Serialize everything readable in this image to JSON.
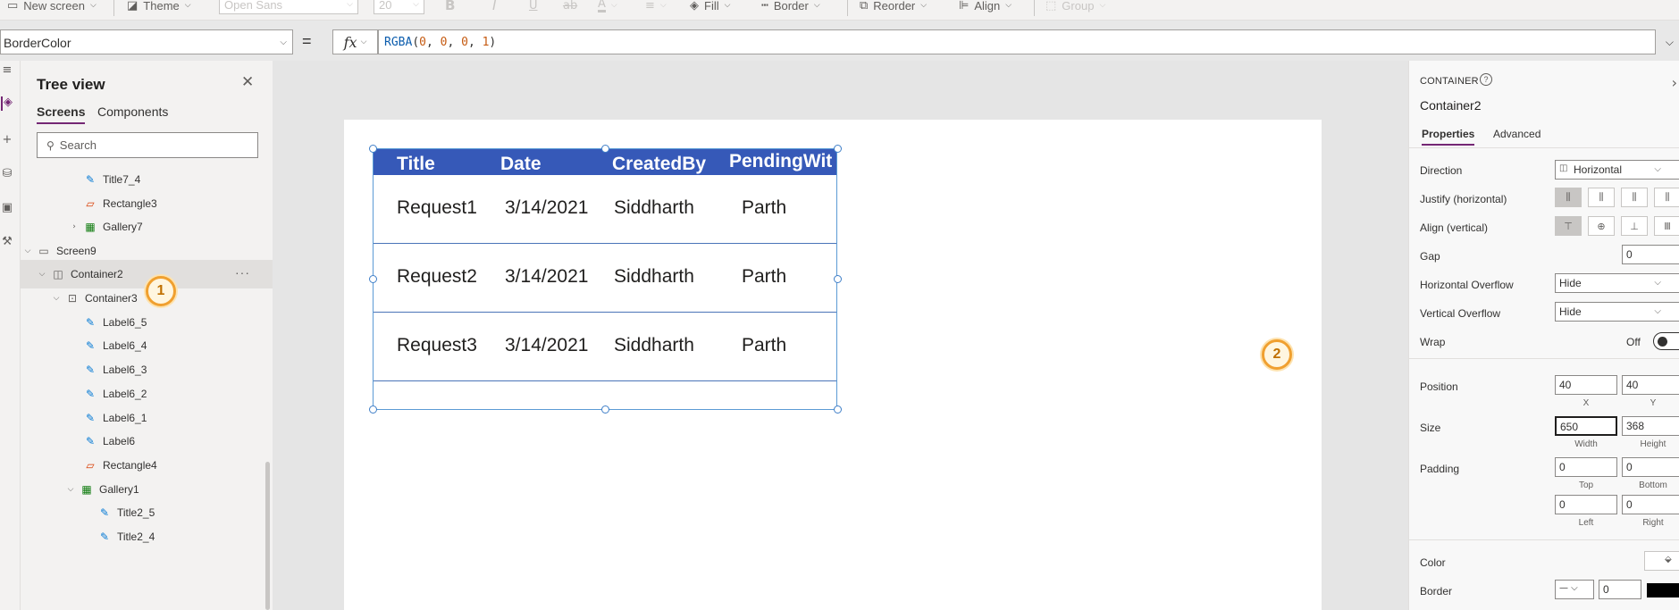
{
  "toolbar": {
    "new_screen": "New screen",
    "theme": "Theme",
    "font": "Open Sans",
    "font_size": "20",
    "fill": "Fill",
    "border": "Border",
    "reorder": "Reorder",
    "align": "Align",
    "group": "Group"
  },
  "formula_bar": {
    "property": "BorderColor",
    "equals": "=",
    "fx": "fx",
    "func": "RGBA",
    "args": [
      "0",
      "0",
      "0",
      "1"
    ]
  },
  "tree_view": {
    "title": "Tree view",
    "tabs": [
      "Screens",
      "Components"
    ],
    "search_placeholder": "Search",
    "items": [
      {
        "label": "Title7_4",
        "type": "label"
      },
      {
        "label": "Rectangle3",
        "type": "rectangle"
      },
      {
        "label": "Gallery7",
        "type": "gallery"
      },
      {
        "label": "Screen9",
        "type": "screen"
      },
      {
        "label": "Container2",
        "type": "container"
      },
      {
        "label": "Container3",
        "type": "container"
      },
      {
        "label": "Label6_5",
        "type": "label"
      },
      {
        "label": "Label6_4",
        "type": "label"
      },
      {
        "label": "Label6_3",
        "type": "label"
      },
      {
        "label": "Label6_2",
        "type": "label"
      },
      {
        "label": "Label6_1",
        "type": "label"
      },
      {
        "label": "Label6",
        "type": "label"
      },
      {
        "label": "Rectangle4",
        "type": "rectangle"
      },
      {
        "label": "Gallery1",
        "type": "gallery"
      },
      {
        "label": "Title2_5",
        "type": "label"
      },
      {
        "label": "Title2_4",
        "type": "label"
      }
    ]
  },
  "callouts": [
    "1",
    "2"
  ],
  "gallery": {
    "headers": [
      "Title",
      "Date",
      "CreatedBy",
      "PendingWit"
    ],
    "rows": [
      [
        "Request1",
        "3/14/2021",
        "Siddharth",
        "Parth"
      ],
      [
        "Request2",
        "3/14/2021",
        "Siddharth",
        "Parth"
      ],
      [
        "Request3",
        "3/14/2021",
        "Siddharth",
        "Parth"
      ]
    ]
  },
  "properties": {
    "control_type": "CONTAINER",
    "control_name": "Container2",
    "tabs": [
      "Properties",
      "Advanced"
    ],
    "direction_label": "Direction",
    "direction_value": "Horizontal",
    "justify_label": "Justify (horizontal)",
    "align_label": "Align (vertical)",
    "gap_label": "Gap",
    "gap_value": "0",
    "hoverflow_label": "Horizontal Overflow",
    "hoverflow_value": "Hide",
    "voverflow_label": "Vertical Overflow",
    "voverflow_value": "Hide",
    "wrap_label": "Wrap",
    "wrap_value": "Off",
    "position_label": "Position",
    "x_value": "40",
    "y_value": "40",
    "x_sub": "X",
    "y_sub": "Y",
    "size_label": "Size",
    "width_value": "650",
    "height_value": "368",
    "width_sub": "Width",
    "height_sub": "Height",
    "padding_label": "Padding",
    "top_value": "0",
    "bottom_value": "0",
    "left_value": "0",
    "right_value": "0",
    "top_sub": "Top",
    "bottom_sub": "Bottom",
    "left_sub": "Left",
    "right_sub": "Right",
    "color_label": "Color",
    "border_label": "Border",
    "border_width_value": "0"
  },
  "colors": {
    "header_fill": "#3659b8",
    "accent": "#742774",
    "selection": "#5b9bd5",
    "callout": "#f0a030"
  }
}
